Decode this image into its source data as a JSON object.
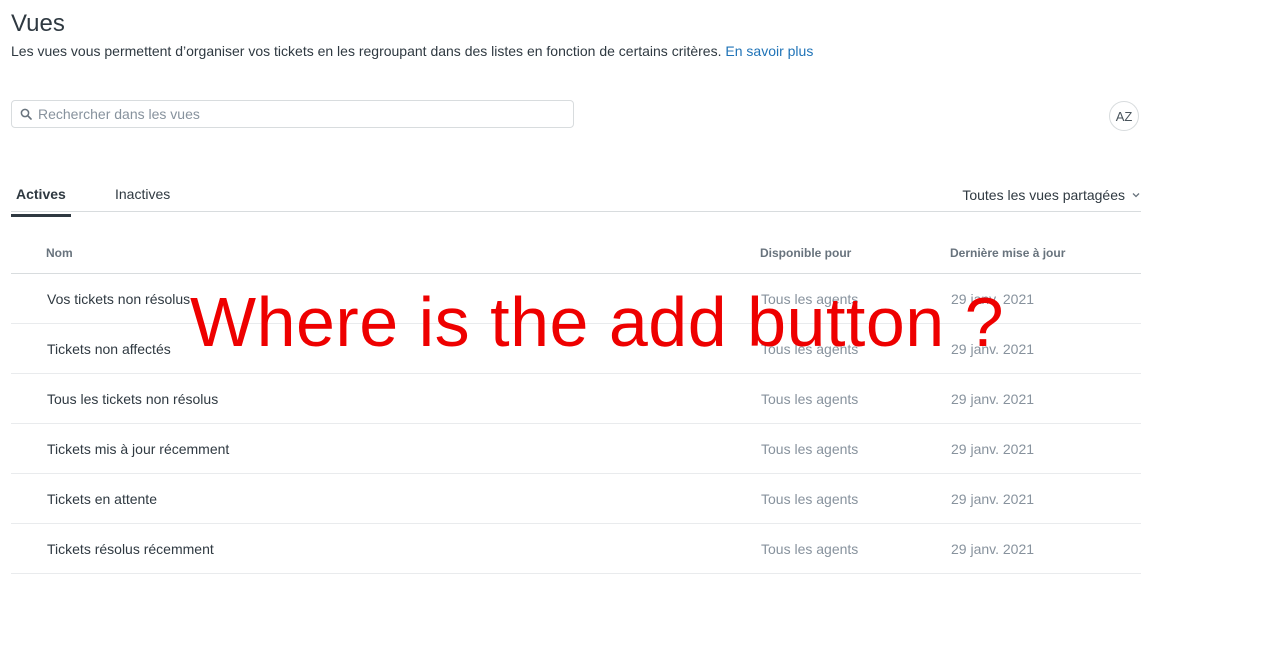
{
  "header": {
    "title": "Vues",
    "description": "Les vues vous permettent d’organiser vos tickets en les regroupant dans des listes en fonction de certains critères.",
    "learn_more": "En savoir plus"
  },
  "search": {
    "placeholder": "Rechercher dans les vues",
    "icon": "search-icon"
  },
  "sort_button": {
    "icon": "sort-az-icon",
    "label": "AZ"
  },
  "tabs": [
    {
      "label": "Actives",
      "active": true
    },
    {
      "label": "Inactives",
      "active": false
    }
  ],
  "filter": {
    "label": "Toutes les vues partagées",
    "icon": "chevron-down-icon"
  },
  "table": {
    "columns": [
      "Nom",
      "Disponible pour",
      "Dernière mise à jour"
    ],
    "rows": [
      {
        "name": "Vos tickets non résolus",
        "available": "Tous les agents",
        "updated": "29 janv. 2021"
      },
      {
        "name": "Tickets non affectés",
        "available": "Tous les agents",
        "updated": "29 janv. 2021"
      },
      {
        "name": "Tous les tickets non résolus",
        "available": "Tous les agents",
        "updated": "29 janv. 2021"
      },
      {
        "name": "Tickets mis à jour récemment",
        "available": "Tous les agents",
        "updated": "29 janv. 2021"
      },
      {
        "name": "Tickets en attente",
        "available": "Tous les agents",
        "updated": "29 janv. 2021"
      },
      {
        "name": "Tickets résolus récemment",
        "available": "Tous les agents",
        "updated": "29 janv. 2021"
      }
    ]
  },
  "annotation": {
    "text": "Where is the add button ?",
    "color": "#ee0000"
  },
  "colors": {
    "link": "#1f73b7",
    "text": "#2f3941",
    "muted": "#87929d",
    "border": "#d8dcde"
  }
}
